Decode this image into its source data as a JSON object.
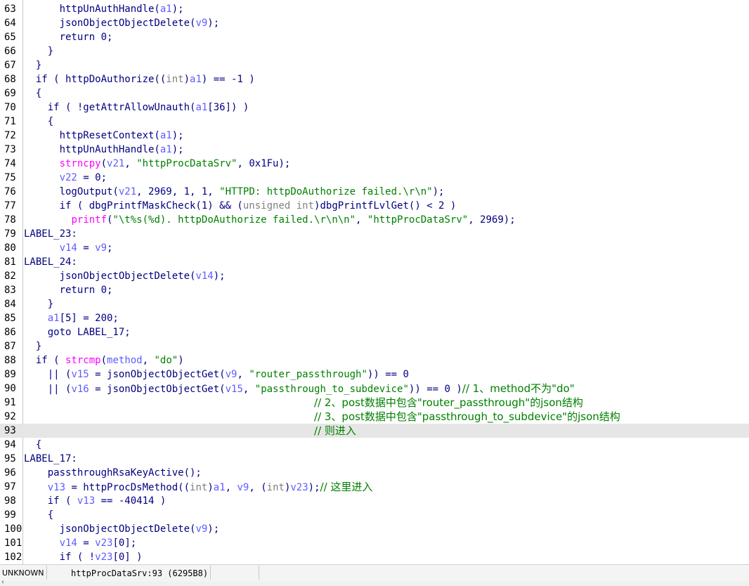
{
  "status_bar": {
    "mode": "UNKNOWN",
    "location": "httpProcDataSrv:93 (6295B8)"
  },
  "highlighted_line": "93",
  "icons": {
    "scroll_left": "chevron-left-icon"
  },
  "lines": [
    {
      "n": "63",
      "tokens": [
        [
          "k",
          "      httpUnAuthHandle("
        ],
        [
          "v",
          "a1"
        ],
        [
          "k",
          ");"
        ]
      ]
    },
    {
      "n": "64",
      "tokens": [
        [
          "k",
          "      jsonObjectObjectDelete("
        ],
        [
          "v",
          "v9"
        ],
        [
          "k",
          ");"
        ]
      ]
    },
    {
      "n": "65",
      "tokens": [
        [
          "k",
          "      return 0;"
        ]
      ]
    },
    {
      "n": "66",
      "tokens": [
        [
          "k",
          "    }"
        ]
      ]
    },
    {
      "n": "67",
      "tokens": [
        [
          "k",
          "  }"
        ]
      ]
    },
    {
      "n": "68",
      "tokens": [
        [
          "k",
          "  if ( httpDoAuthorize(("
        ],
        [
          "g",
          "int"
        ],
        [
          "k",
          ")"
        ],
        [
          "v",
          "a1"
        ],
        [
          "k",
          ") == -1 )"
        ]
      ]
    },
    {
      "n": "69",
      "tokens": [
        [
          "k",
          "  {"
        ]
      ]
    },
    {
      "n": "70",
      "tokens": [
        [
          "k",
          "    if ( !getAttrAllowUnauth("
        ],
        [
          "v",
          "a1"
        ],
        [
          "k",
          "[36]) )"
        ]
      ]
    },
    {
      "n": "71",
      "tokens": [
        [
          "k",
          "    {"
        ]
      ]
    },
    {
      "n": "72",
      "tokens": [
        [
          "k",
          "      httpResetContext("
        ],
        [
          "v",
          "a1"
        ],
        [
          "k",
          ");"
        ]
      ]
    },
    {
      "n": "73",
      "tokens": [
        [
          "k",
          "      httpUnAuthHandle("
        ],
        [
          "v",
          "a1"
        ],
        [
          "k",
          ");"
        ]
      ]
    },
    {
      "n": "74",
      "tokens": [
        [
          "k",
          "      "
        ],
        [
          "f",
          "strncpy"
        ],
        [
          "k",
          "("
        ],
        [
          "v",
          "v21"
        ],
        [
          "k",
          ", "
        ],
        [
          "s",
          "\"httpProcDataSrv\""
        ],
        [
          "k",
          ", 0x1Fu);"
        ]
      ]
    },
    {
      "n": "75",
      "tokens": [
        [
          "k",
          "      "
        ],
        [
          "v",
          "v22"
        ],
        [
          "k",
          " = 0;"
        ]
      ]
    },
    {
      "n": "76",
      "tokens": [
        [
          "k",
          "      logOutput("
        ],
        [
          "v",
          "v21"
        ],
        [
          "k",
          ", 2969, 1, 1, "
        ],
        [
          "s",
          "\"HTTPD: httpDoAuthorize failed.\\r\\n\""
        ],
        [
          "k",
          ");"
        ]
      ]
    },
    {
      "n": "77",
      "tokens": [
        [
          "k",
          "      if ( dbgPrintfMaskCheck(1) && ("
        ],
        [
          "g",
          "unsigned int"
        ],
        [
          "k",
          ")dbgPrintfLvlGet() < 2 )"
        ]
      ]
    },
    {
      "n": "78",
      "tokens": [
        [
          "k",
          "        "
        ],
        [
          "f",
          "printf"
        ],
        [
          "k",
          "("
        ],
        [
          "s",
          "\"\\t%s(%d). httpDoAuthorize failed.\\r\\n\\n\""
        ],
        [
          "k",
          ", "
        ],
        [
          "s",
          "\"httpProcDataSrv\""
        ],
        [
          "k",
          ", 2969);"
        ]
      ]
    },
    {
      "n": "79",
      "tokens": [
        [
          "k",
          "LABEL_23:"
        ]
      ]
    },
    {
      "n": "80",
      "tokens": [
        [
          "k",
          "      "
        ],
        [
          "v",
          "v14"
        ],
        [
          "k",
          " = "
        ],
        [
          "v",
          "v9"
        ],
        [
          "k",
          ";"
        ]
      ]
    },
    {
      "n": "81",
      "tokens": [
        [
          "k",
          "LABEL_24:"
        ]
      ]
    },
    {
      "n": "82",
      "tokens": [
        [
          "k",
          "      jsonObjectObjectDelete("
        ],
        [
          "v",
          "v14"
        ],
        [
          "k",
          ");"
        ]
      ]
    },
    {
      "n": "83",
      "tokens": [
        [
          "k",
          "      return 0;"
        ]
      ]
    },
    {
      "n": "84",
      "tokens": [
        [
          "k",
          "    }"
        ]
      ]
    },
    {
      "n": "85",
      "tokens": [
        [
          "k",
          "    "
        ],
        [
          "v",
          "a1"
        ],
        [
          "k",
          "[5] = 200;"
        ]
      ]
    },
    {
      "n": "86",
      "tokens": [
        [
          "k",
          "    goto LABEL_17;"
        ]
      ]
    },
    {
      "n": "87",
      "tokens": [
        [
          "k",
          "  }"
        ]
      ]
    },
    {
      "n": "88",
      "tokens": [
        [
          "k",
          "  if ( "
        ],
        [
          "f",
          "strcmp"
        ],
        [
          "k",
          "("
        ],
        [
          "v",
          "method"
        ],
        [
          "k",
          ", "
        ],
        [
          "s",
          "\"do\""
        ],
        [
          "k",
          ")"
        ]
      ]
    },
    {
      "n": "89",
      "tokens": [
        [
          "k",
          "    || ("
        ],
        [
          "v",
          "v15"
        ],
        [
          "k",
          " = jsonObjectObjectGet("
        ],
        [
          "v",
          "v9"
        ],
        [
          "k",
          ", "
        ],
        [
          "s",
          "\"router_passthrough\""
        ],
        [
          "k",
          ")) == 0"
        ]
      ]
    },
    {
      "n": "90",
      "tokens": [
        [
          "k",
          "    || ("
        ],
        [
          "v",
          "v16"
        ],
        [
          "k",
          " = jsonObjectObjectGet("
        ],
        [
          "v",
          "v15"
        ],
        [
          "k",
          ", "
        ],
        [
          "s",
          "\"passthrough_to_subdevice\""
        ],
        [
          "k",
          ")) == 0 )"
        ],
        [
          "c",
          "// 1、method不为\"do\""
        ]
      ]
    },
    {
      "n": "91",
      "tokens": [
        [
          "k",
          "                                                 "
        ],
        [
          "c",
          "// 2、post数据中包含\"router_passthrough\"的json结构"
        ]
      ]
    },
    {
      "n": "92",
      "tokens": [
        [
          "k",
          "                                                 "
        ],
        [
          "c",
          "// 3、post数据中包含\"passthrough_to_subdevice\"的json结构"
        ]
      ]
    },
    {
      "n": "93",
      "tokens": [
        [
          "k",
          "                                                 "
        ],
        [
          "c",
          "// 则进入"
        ]
      ]
    },
    {
      "n": "94",
      "tokens": [
        [
          "k",
          "  {"
        ]
      ]
    },
    {
      "n": "95",
      "tokens": [
        [
          "k",
          "LABEL_17:"
        ]
      ]
    },
    {
      "n": "96",
      "tokens": [
        [
          "k",
          "    passthroughRsaKeyActive();"
        ]
      ]
    },
    {
      "n": "97",
      "tokens": [
        [
          "k",
          "    "
        ],
        [
          "v",
          "v13"
        ],
        [
          "k",
          " = httpProcDsMethod(("
        ],
        [
          "g",
          "int"
        ],
        [
          "k",
          ")"
        ],
        [
          "v",
          "a1"
        ],
        [
          "k",
          ", "
        ],
        [
          "v",
          "v9"
        ],
        [
          "k",
          ", ("
        ],
        [
          "g",
          "int"
        ],
        [
          "k",
          ")"
        ],
        [
          "v",
          "v23"
        ],
        [
          "k",
          ");"
        ],
        [
          "c",
          "// 这里进入"
        ]
      ]
    },
    {
      "n": "98",
      "tokens": [
        [
          "k",
          "    if ( "
        ],
        [
          "v",
          "v13"
        ],
        [
          "k",
          " == -40414 )"
        ]
      ]
    },
    {
      "n": "99",
      "tokens": [
        [
          "k",
          "    {"
        ]
      ]
    },
    {
      "n": "100",
      "tokens": [
        [
          "k",
          "      jsonObjectObjectDelete("
        ],
        [
          "v",
          "v9"
        ],
        [
          "k",
          ");"
        ]
      ]
    },
    {
      "n": "101",
      "tokens": [
        [
          "k",
          "      "
        ],
        [
          "v",
          "v14"
        ],
        [
          "k",
          " = "
        ],
        [
          "v",
          "v23"
        ],
        [
          "k",
          "[0];"
        ]
      ]
    },
    {
      "n": "102",
      "tokens": [
        [
          "k",
          "      if ( !"
        ],
        [
          "v",
          "v23"
        ],
        [
          "k",
          "[0] )"
        ]
      ]
    }
  ]
}
